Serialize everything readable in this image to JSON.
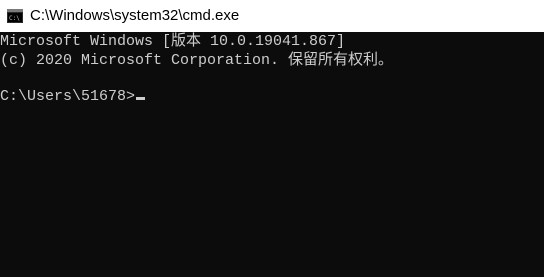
{
  "window": {
    "title": "C:\\Windows\\system32\\cmd.exe",
    "icon": "console-icon",
    "background_color": "#0c0c0c",
    "text_color": "#cccccc"
  },
  "console": {
    "lines": [
      "Microsoft Windows [版本 10.0.19041.867]",
      "(c) 2020 Microsoft Corporation. 保留所有权利。"
    ],
    "prompt": "C:\\Users\\51678>",
    "input": ""
  }
}
